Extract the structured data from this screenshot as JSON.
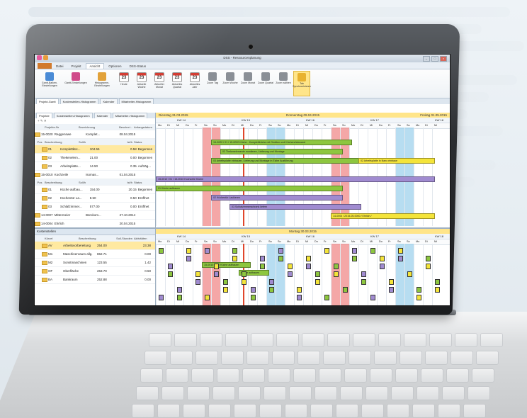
{
  "window": {
    "title": "DSS - Ressourcenplanung",
    "controls": [
      "–",
      "□",
      "×"
    ]
  },
  "ribbon_tabs": [
    {
      "label": ""
    },
    {
      "label": "Datei"
    },
    {
      "label": "Projekt"
    },
    {
      "label": "Ansicht"
    },
    {
      "label": "Optionen"
    },
    {
      "label": "DSS-Status"
    }
  ],
  "ribbon_buttons": [
    {
      "label": "Gantt-Balken-Einstellungen",
      "icon": "gantt-icon",
      "color": "#4a8bd6"
    },
    {
      "label": "Gantt-Einstellungen",
      "icon": "settings-icon",
      "color": "#d04a8a"
    },
    {
      "label": "Histogramm-Einstellungen",
      "icon": "histogram-icon",
      "color": "#e2a23a"
    },
    {
      "label": "Heute",
      "icon": "calendar-icon",
      "day": "23"
    },
    {
      "label": "Aktuelle Woche",
      "icon": "calendar-icon",
      "day": "23"
    },
    {
      "label": "Aktueller Monat",
      "icon": "calendar-icon",
      "day": "23"
    },
    {
      "label": "Aktuelles Quartal",
      "icon": "calendar-icon",
      "day": "23"
    },
    {
      "label": "Aktuelles Jahr",
      "icon": "calendar-icon",
      "day": "23"
    },
    {
      "label": "Zoom Tag",
      "icon": "zoom-icon",
      "color": "#8a8f96"
    },
    {
      "label": "Zoom Woche",
      "icon": "zoom-icon",
      "color": "#8a8f96"
    },
    {
      "label": "Zoom Monat",
      "icon": "zoom-icon",
      "color": "#8a8f96"
    },
    {
      "label": "Zoom Quartal",
      "icon": "zoom-icon",
      "color": "#8a8f96"
    },
    {
      "label": "Zoom wählen",
      "icon": "zoom-icon",
      "color": "#8a8f96"
    },
    {
      "label": "Tab Synchronisieren",
      "icon": "sync-icon",
      "color": "#e8b230"
    }
  ],
  "view_tabs": [
    "Projekt-Gantt",
    "Kostenstellen-Histogramm",
    "Kalender",
    "Mitarbeiter-Histogramm"
  ],
  "left_top": {
    "pane_tabs": [
      "Projekte",
      "Kostenstellen-Histogramm",
      "Kalender",
      "Mitarbeiter-Histogramm"
    ],
    "toolbar": "+ ✎ ✕",
    "header": [
      "",
      "Projekte-Nr",
      "Bezeichnung",
      "Beschrei...",
      "Anfangsdatum"
    ],
    "rows": [
      {
        "c1": "15-0020",
        "c2": "Reggenswe",
        "c3": "Komplet...",
        "c4": "08.04.2015",
        "c5": "",
        "kind": "project"
      },
      {
        "c1": "Pos",
        "c2": "Beschreibung",
        "c3": "Soll/h",
        "c4": "Ist/h",
        "c5": "Status",
        "kind": "hdr"
      },
      {
        "c1": "01",
        "c2": "Komplettküc...",
        "c3": "104.55",
        "c4": "0.58",
        "c5": "Begonnen",
        "kind": "sel"
      },
      {
        "c1": "02",
        "c2": "Thekenelem...",
        "c3": "21.00",
        "c4": "0.00",
        "c5": "Begonnen",
        "kind": "sub"
      },
      {
        "c1": "03",
        "c2": "Arbeitsplatte...",
        "c3": "14.50",
        "c4": "0.35",
        "c5": "Aufträg...",
        "kind": "sub"
      },
      {
        "c1": "15-0010",
        "c2": "Kochzeile",
        "c3": "Isomas...",
        "c4": "01.04.2015",
        "c5": "",
        "kind": "project"
      },
      {
        "c1": "Pos",
        "c2": "Beschreibung",
        "c3": "Soll/h",
        "c4": "Ist/h",
        "c5": "Status",
        "kind": "hdr"
      },
      {
        "c1": "01",
        "c2": "Küche aufbau...",
        "c3": "154.00",
        "c4": "20.15",
        "c5": "Begonnen",
        "kind": "sub"
      },
      {
        "c1": "02",
        "c2": "Küchentür La...",
        "c3": "8.50",
        "c4": "0.50",
        "c5": "Eröffnet",
        "kind": "sub"
      },
      {
        "c1": "03",
        "c2": "Schlafzimmer...",
        "c3": "577.00",
        "c4": "0.00",
        "c5": "Eröffnet",
        "kind": "sub"
      },
      {
        "c1": "14-0007",
        "c2": "Mittermeier",
        "c3": "Bürokom...",
        "c4": "27.10.2014",
        "c5": "",
        "kind": "project"
      },
      {
        "c1": "14-0004",
        "c2": "Ehrlich",
        "c3": "",
        "c4": "20.04.2015",
        "c5": "",
        "kind": "project"
      }
    ]
  },
  "left_bottom": {
    "title": "Kostenstellen",
    "header": [
      "",
      "Kürzel",
      "Beschreibung",
      "Soll-Stunden",
      "Aktivitäten"
    ],
    "rows": [
      {
        "c1": "AV",
        "c2": "Arbeitsvorbereitung",
        "c3": "254.00",
        "c4": "23.38",
        "kind": "sel"
      },
      {
        "c1": "M1",
        "c2": "Maschinenraum allg.",
        "c3": "862.71",
        "c4": "0.00",
        "kind": "sub"
      },
      {
        "c1": "M2",
        "c2": "Sonstmaschinen",
        "c3": "123.55",
        "c4": "1.42",
        "kind": "sub"
      },
      {
        "c1": "OF",
        "c2": "Oberfläche",
        "c3": "263.70",
        "c4": "0.50",
        "kind": "sub"
      },
      {
        "c1": "BA",
        "c2": "Bankraum",
        "c3": "252.88",
        "c4": "0.00",
        "kind": "sub"
      }
    ]
  },
  "gantt_top": {
    "banner_left": "Dienstag 31.03.2015",
    "banner_center": "Donnerstag 09.04.2015",
    "banner_right": "Freitag 01.05.2015",
    "weeks": [
      "KW 14",
      "KW 15",
      "KW 16",
      "KW 17",
      "KW 18"
    ],
    "days": [
      "Mo",
      "Di",
      "Mi",
      "Do",
      "Fr",
      "Sa",
      "So",
      "Mo",
      "Di",
      "Mi",
      "Do",
      "Fr",
      "Sa",
      "So",
      "Mo",
      "Di",
      "Mi",
      "Do",
      "Fr",
      "Sa",
      "So",
      "Mo",
      "Di",
      "Mi",
      "Do",
      "Fr",
      "Sa",
      "So",
      "Mo",
      "Di",
      "Mi"
    ],
    "bars": [
      {
        "label": "15-0020 / 01 / 15-0020 Küche - Komplettküche mit Geräten und Küchenrückwand",
        "color": "green",
        "start": 6,
        "end": 21,
        "row": 1
      },
      {
        "label": "02 Thekenelemente montieren, Lieferung und Montage",
        "color": "green",
        "start": 7,
        "end": 20,
        "row": 2
      },
      {
        "label": "03 Arbeitsplatte einbauen, Lieferung und Montage in Eiche Ausführung",
        "color": "green",
        "start": 6,
        "end": 22,
        "row": 3
      },
      {
        "label": "02 Arbeitsplatte in Nano einbaue",
        "color": "yellow",
        "start": 22,
        "end": 30,
        "row": 3
      },
      {
        "label": "15-0010 / 01 / 15-0010 Kochzeile Küche",
        "color": "purple",
        "start": 0,
        "end": 30,
        "row": 5
      },
      {
        "label": "01 Küche aufbauen",
        "color": "green",
        "start": 0,
        "end": 20,
        "row": 6
      },
      {
        "label": "02 Küchentür Lackieren",
        "color": "purple",
        "start": 6,
        "end": 20,
        "row": 7
      },
      {
        "label": "03 Schlafzimmerschrank liefern",
        "color": "purple",
        "start": 8,
        "end": 22,
        "row": 8
      },
      {
        "label": "14-0004 / 2015-05-0000 / Ehrlich /",
        "color": "yellow",
        "start": 19,
        "end": 30,
        "row": 9
      }
    ]
  },
  "gantt_bottom": {
    "banner": "Montag 30.03.2015",
    "weeks": [
      "KW 14",
      "KW 15",
      "KW 16",
      "KW 17",
      "KW 18"
    ],
    "bars": [
      {
        "label": "15-0010 / 01 / Küche aufbauen",
        "color": "green",
        "start": 5,
        "end": 10,
        "row": 2
      },
      {
        "label": "Küche aufbauen",
        "color": "green",
        "start": 9,
        "end": 12,
        "row": 3
      }
    ]
  },
  "colors": {
    "weekend_red": "#f08a8a",
    "weekend_blue": "#9fd2ec",
    "today_line": "#e0462c",
    "bar_green": "#8dc63f",
    "bar_purple": "#a08bd0",
    "bar_yellow": "#f4e43a",
    "accent_orange": "#d27a2c"
  }
}
